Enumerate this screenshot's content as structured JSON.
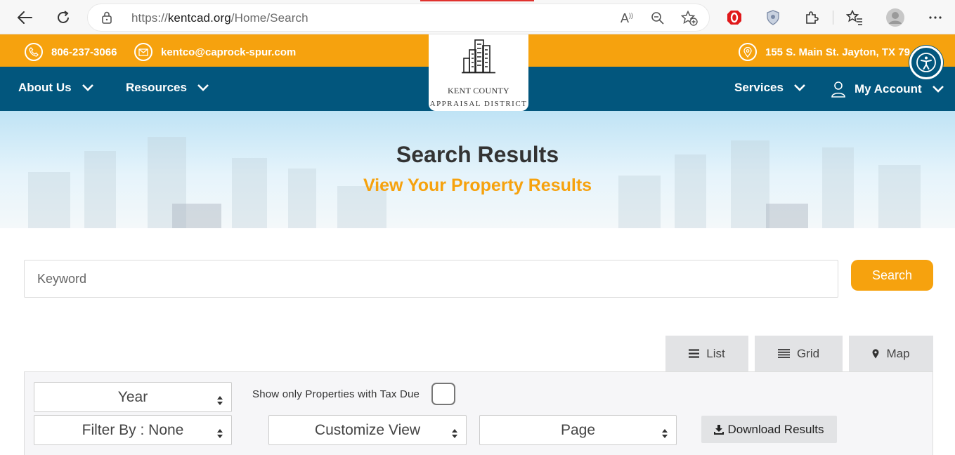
{
  "browser": {
    "url_scheme": "https://",
    "url_host": "kentcad.org",
    "url_path": "/Home/Search",
    "reader_label": "A"
  },
  "topbar": {
    "phone": "806-237-3066",
    "email": "kentco@caprock-spur.com",
    "address": "155 S. Main St. Jayton, TX 79"
  },
  "nav": {
    "about": "About Us",
    "resources": "Resources",
    "services": "Services",
    "account": "My Account"
  },
  "logo": {
    "line1": "KENT COUNTY",
    "line2": "APPRAISAL DISTRICT"
  },
  "hero": {
    "title": "Search Results",
    "subtitle": "View Your Property Results"
  },
  "search": {
    "placeholder": "Keyword",
    "button": "Search"
  },
  "views": {
    "list": "List",
    "grid": "Grid",
    "map": "Map"
  },
  "filters": {
    "year": "Year",
    "tax_due_label": "Show only Properties with Tax Due",
    "tax_due_checked": false,
    "filter_by": "Filter By : None",
    "customize": "Customize View",
    "page": "Page",
    "download": "Download Results"
  },
  "colors": {
    "orange": "#f6a20e",
    "navy": "#02567d"
  },
  "icons": [
    "back-icon",
    "refresh-icon",
    "lock-icon",
    "read-aloud-icon",
    "zoom-out-icon",
    "add-favorite-icon",
    "opera-icon",
    "shield-icon",
    "extensions-icon",
    "favorites-icon",
    "profile-icon",
    "more-icon",
    "phone-icon",
    "mail-icon",
    "location-icon",
    "accessibility-icon",
    "user-icon",
    "chevron-down-icon",
    "list-icon",
    "grid-icon",
    "map-pin-icon",
    "download-icon"
  ]
}
